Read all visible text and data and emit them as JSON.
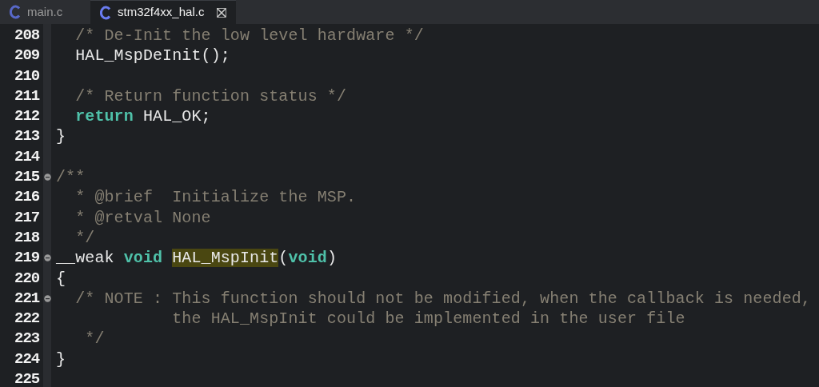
{
  "tabs": [
    {
      "label": "main.c",
      "selected": false,
      "closable": false
    },
    {
      "label": "stm32f4xx_hal.c",
      "selected": true,
      "closable": true
    }
  ],
  "editor": {
    "lines": [
      {
        "number": "208",
        "foldable": false,
        "segments": [
          {
            "kind": "comment",
            "text": "  /* De-Init the low level hardware */"
          }
        ]
      },
      {
        "number": "209",
        "foldable": false,
        "segments": [
          {
            "kind": "plain",
            "text": "  HAL_MspDeInit();"
          }
        ]
      },
      {
        "number": "210",
        "foldable": false
      },
      {
        "number": "211",
        "foldable": false,
        "segments": [
          {
            "kind": "comment",
            "text": "  /* Return function status */"
          }
        ]
      },
      {
        "number": "212",
        "foldable": false,
        "segments": [
          {
            "kind": "keyword",
            "text": "  return"
          },
          {
            "kind": "plain",
            "text": " HAL_OK;"
          }
        ]
      },
      {
        "number": "213",
        "foldable": false,
        "segments": [
          {
            "kind": "plain",
            "text": "}"
          }
        ]
      },
      {
        "number": "214",
        "foldable": false
      },
      {
        "number": "215",
        "foldable": true,
        "segments": [
          {
            "kind": "comment",
            "text": "/**"
          }
        ]
      },
      {
        "number": "216",
        "foldable": false,
        "segments": [
          {
            "kind": "comment",
            "text": "  * @brief  Initialize the MSP."
          }
        ]
      },
      {
        "number": "217",
        "foldable": false,
        "segments": [
          {
            "kind": "comment",
            "text": "  * @retval None"
          }
        ]
      },
      {
        "number": "218",
        "foldable": false,
        "segments": [
          {
            "kind": "comment",
            "text": "  */"
          }
        ]
      },
      {
        "number": "219",
        "foldable": true,
        "segments": [
          {
            "kind": "plain",
            "text": "__weak "
          },
          {
            "kind": "keyword",
            "text": "void "
          },
          {
            "kind": "highlight",
            "text": "HAL_MspInit"
          },
          {
            "kind": "plain",
            "text": "("
          },
          {
            "kind": "keyword",
            "text": "void"
          },
          {
            "kind": "plain",
            "text": ")"
          }
        ]
      },
      {
        "number": "220",
        "foldable": false,
        "segments": [
          {
            "kind": "plain",
            "text": "{"
          }
        ]
      },
      {
        "number": "221",
        "foldable": true,
        "segments": [
          {
            "kind": "comment",
            "text": "  /* NOTE : This function should not be modified, when the callback is needed,"
          }
        ]
      },
      {
        "number": "222",
        "foldable": false,
        "segments": [
          {
            "kind": "comment",
            "text": "            the HAL_MspInit could be implemented in the user file"
          }
        ]
      },
      {
        "number": "223",
        "foldable": false,
        "segments": [
          {
            "kind": "comment",
            "text": "   */"
          }
        ]
      },
      {
        "number": "224",
        "foldable": false,
        "segments": [
          {
            "kind": "plain",
            "text": "}"
          }
        ]
      },
      {
        "number": "225",
        "foldable": false
      }
    ]
  }
}
